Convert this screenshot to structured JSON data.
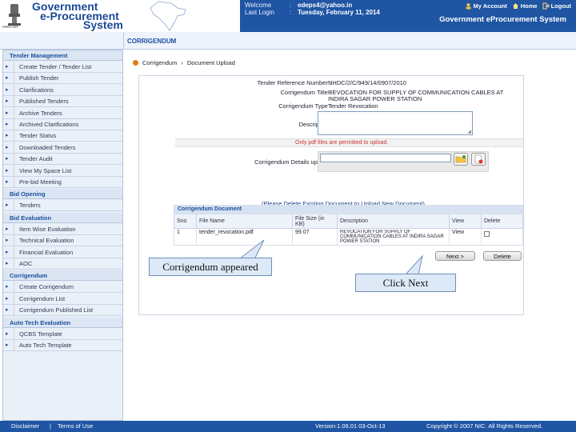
{
  "header": {
    "brand_line1": "Government",
    "brand_line2": "e-Procurement",
    "brand_line3": "System",
    "emblem_caption": "सत्यमेव जयते",
    "welcome_label": "Welcome",
    "welcome_value": "edeps4@yahoo.in",
    "last_login_label": "Last Login",
    "last_login_value": "Tuesday, February 11, 2014",
    "colon": ":",
    "my_account": "My Account",
    "home": "Home",
    "logout": "Logout",
    "system_title": "Government eProcurement System"
  },
  "subbar": {
    "heading": "CORRIGENDUM"
  },
  "sidebar": {
    "sections": [
      {
        "title": "Tender Management",
        "items": [
          "Create Tender / Tender List",
          "Publish Tender",
          "Clarifications",
          "Published Tenders",
          "Archive Tenders",
          "Archived Clarifications",
          "Tender Status",
          "Downloaded Tenders",
          "Tender Audit",
          "View My Space List",
          "Pre-bid Meeting"
        ]
      },
      {
        "title": "Bid Opening",
        "items": [
          "Tenders"
        ]
      },
      {
        "title": "Bid Evaluation",
        "items": [
          "Item Wise Evaluation",
          "Technical Evaluation",
          "Financial Evaluation",
          "AOC"
        ]
      },
      {
        "title": "Corrigendum",
        "items": [
          "Create Corrigendum",
          "Corrigendum List",
          "Corrigendum Published List"
        ]
      },
      {
        "title": "Auto Tech Evaluation",
        "items": [
          "QCBS Template",
          "Auto Tech Template"
        ]
      }
    ]
  },
  "breadcrumb": {
    "root": "Corrigendum",
    "separator": "›",
    "current": "Document Upload"
  },
  "form": {
    "ref_label": "Tender Reference Number :",
    "ref_value": "NHDC/2/C/949/14/0907/2010",
    "title_label": "Corrigendum Title :",
    "title_value_line1": "REVOCATION FOR SUPPLY OF COMMUNICATION CABLES AT",
    "title_value_line2": "INDIRA SAGAR POWER STATION",
    "type_label": "Corrigendum Type :",
    "type_value": "Tender Revocation",
    "description_label": "Description*",
    "description_value": "",
    "pdf_note": "Only pdf files are permitted to upload.",
    "upload_label": "Corrigendum Details upload*",
    "file_value": "",
    "delete_note": "(Please Delete Existing Document to Upload New Document)"
  },
  "table": {
    "caption": "Corrigendum Document",
    "headers": [
      "Sno",
      "File Name",
      "File Size (in KB)",
      "Description",
      "View",
      "Delete"
    ],
    "rows": [
      {
        "sno": "1",
        "file_name": "tender_revocation.pdf",
        "file_size": "99.07",
        "description": "REVOCATION FOR SUPPLY OF COMMUNICATION CABLES AT INDIRA SAGAR POWER STATION",
        "view": "View"
      }
    ]
  },
  "buttons": {
    "next": "Next >",
    "delete": "Delete"
  },
  "callouts": {
    "first": "Corrigendum appeared",
    "second": "Click Next"
  },
  "footer": {
    "disclaimer": "Disclaimer",
    "divider": "|",
    "terms": "Terms of Use",
    "version": "Version:1.09.01 03-Oct-13",
    "copyright": "Copyright © 2007 NIC. All Rights Reserved."
  },
  "colors": {
    "header_blue": "#1f55a3",
    "accent_orange": "#e37b12",
    "callout_fill": "#dde9f7"
  }
}
